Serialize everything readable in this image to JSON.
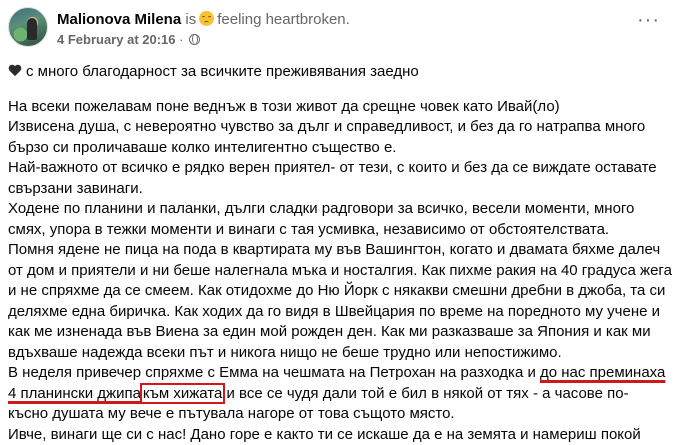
{
  "post": {
    "author": "Malionova Milena",
    "is_text": "is",
    "feeling_text": "feeling heartbroken.",
    "feeling_emoji": "heartbroken-face-icon",
    "date": "4 February at 20:16",
    "separator": "·",
    "privacy_icon": "globe-icon",
    "more_label": "···"
  },
  "content": {
    "intro": "с много благодарност за всичките преживявания заедно",
    "lines": [
      "На всеки пожелавам поне веднъж в този живот да срещне човек като Ивай(ло)",
      "Извисена душа, с невероятно чувство за дълг и справедливост, и без да го натрапва много",
      "бързо си проличаваше колко интелигентно същество е.",
      "Най-важното от всичко е рядко верен приятел- от тези, с които и без да се виждате оставате",
      "свързани завинаги.",
      "Ходене по планини и паланки, дълги сладки радговори за всичко, весели моменти, много",
      "смях, упора в тежки моменти и винаги с тая усмивка, независимо от обстоятелствата.",
      "Помня ядене не пица на пода в квартирата му във Вашингтон, когато и двамата бяхме далеч",
      "от дом и приятели и ни беше налегнала мъка и носталгия. Как пихме ракия на 40 градуса жега",
      "и не спряхме да се смеем. Как отидохме до Ню Йорк с някакви смешни дребни в джоба, та си",
      "деляхме една биричка. Как ходих да го видя в Швейцария по време на поредното му учене и",
      "как ме изненада във Виена за един мой рожден ден. Как ми разказваше за Япония и как ми",
      "вдъхваше надежда всеки път и никога нищо не беше трудно или непостижимо."
    ],
    "highlight_line1": {
      "a": "В неделя привечер спряхме с Емма на чешмата на Петрохан на разходка и ",
      "b": "до нас преминаха"
    },
    "highlight_line2": {
      "a": "4 планински джипа",
      "b": "към хижата",
      "c": " и все се чудя дали той е бил в някой от тях - а часове по-"
    },
    "tail_lines": [
      "късно душата му вече е пътувала нагоре от това същото място.",
      "Ивче, винаги ще си с нас! Дано горе е както ти се искаше да е на земята и намериш покой"
    ]
  }
}
